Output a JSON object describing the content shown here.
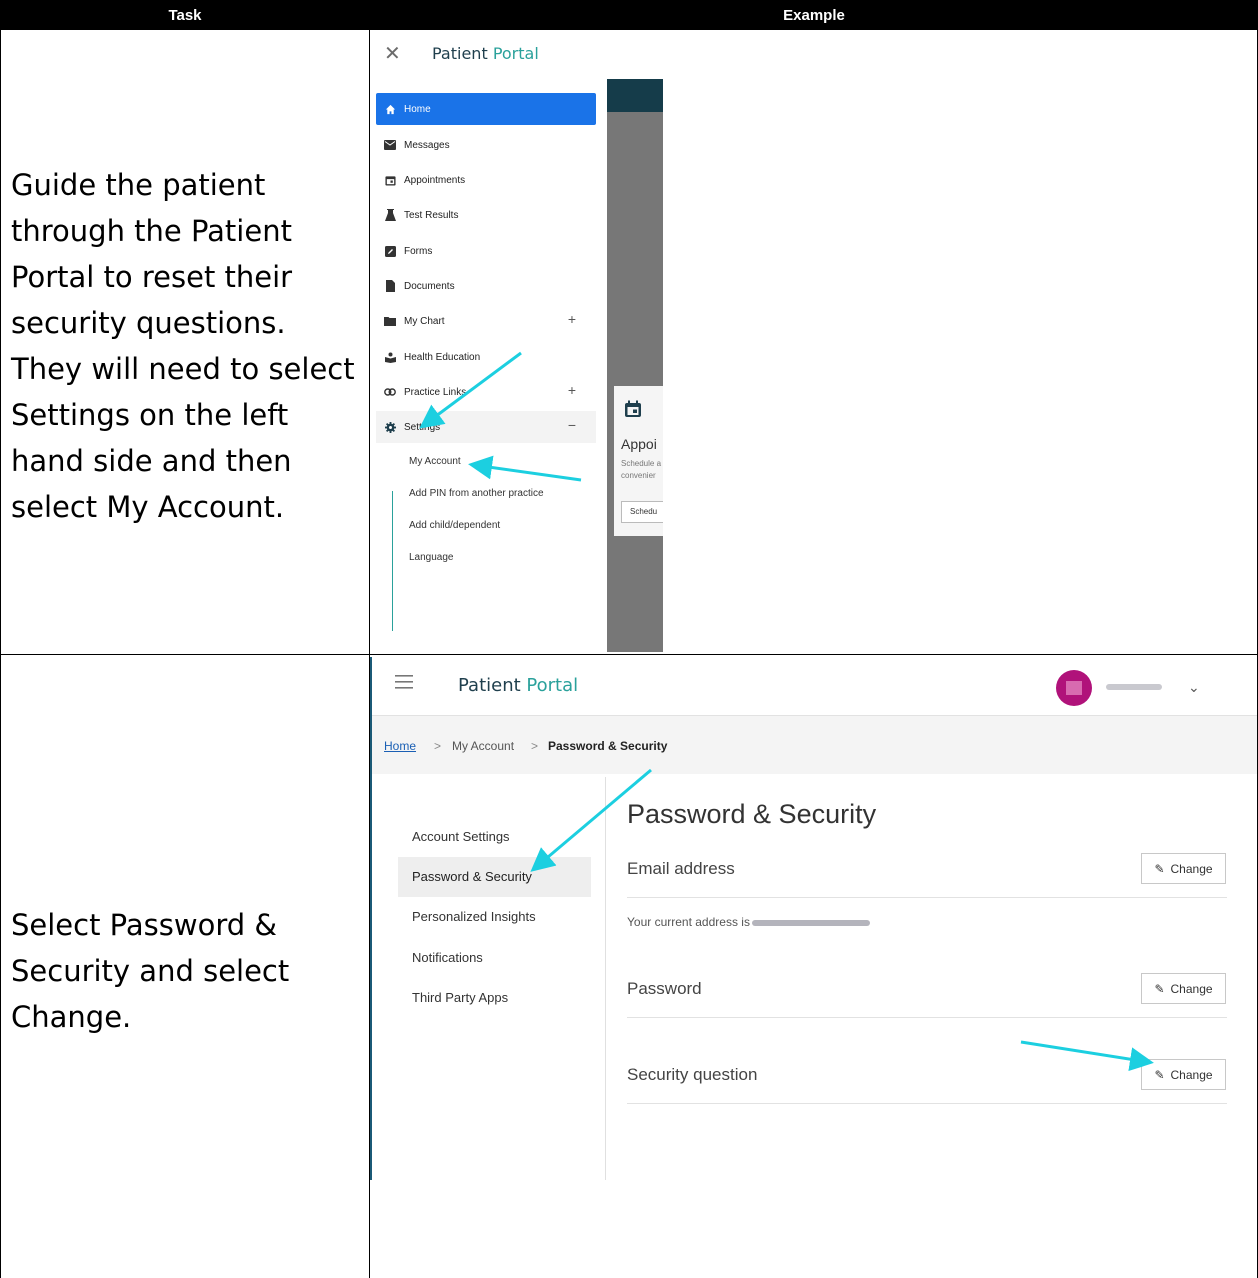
{
  "table": {
    "header_task": "Task",
    "header_example": "Example",
    "rows": [
      {
        "task_lines": [
          "Guide the patient",
          "through the Patient",
          "Portal to reset their",
          "security questions.",
          "They will need to select",
          "Settings on the left",
          "hand side and then",
          "select My Account."
        ]
      },
      {
        "task_lines": [
          "Select Password &",
          "Security and select",
          "Change."
        ]
      }
    ]
  },
  "shot1": {
    "close_icon": "close-icon",
    "title_patient": "Patient",
    "title_portal": "Portal",
    "nav": [
      {
        "label": "Home",
        "icon": "home-icon"
      },
      {
        "label": "Messages",
        "icon": "envelope-icon"
      },
      {
        "label": "Appointments",
        "icon": "calendar-icon"
      },
      {
        "label": "Test Results",
        "icon": "flask-icon"
      },
      {
        "label": "Forms",
        "icon": "pencil-square-icon"
      },
      {
        "label": "Documents",
        "icon": "file-icon"
      },
      {
        "label": "My Chart",
        "icon": "folder-icon",
        "expander": "+"
      },
      {
        "label": "Health Education",
        "icon": "reader-icon"
      },
      {
        "label": "Practice Links",
        "icon": "link-icon",
        "expander": "+"
      },
      {
        "label": "Settings",
        "icon": "gear-icon",
        "expander": "−"
      }
    ],
    "settings_sub": [
      "My Account",
      "Add PIN from another practice",
      "Add child/dependent",
      "Language"
    ],
    "card": {
      "title": "Appoi",
      "line1": "Schedule a",
      "line2": "convenier",
      "button": "Schedu"
    }
  },
  "shot2": {
    "title_patient": "Patient",
    "title_portal": "Portal",
    "breadcrumb": {
      "home": "Home",
      "sep": ">",
      "account": "My Account",
      "current": "Password & Security"
    },
    "leftnav": [
      "Account Settings",
      "Password & Security",
      "Personalized Insights",
      "Notifications",
      "Third Party Apps"
    ],
    "heading": "Password & Security",
    "sections": {
      "email": "Email address",
      "email_text": "Your current address is",
      "password": "Password",
      "security": "Security question"
    },
    "change_label": "Change"
  },
  "colors": {
    "accent_blue": "#1a73e8",
    "portal_teal": "#2aa19b",
    "arrow_cyan": "#1ccfe0",
    "avatar": "#b0127a"
  }
}
